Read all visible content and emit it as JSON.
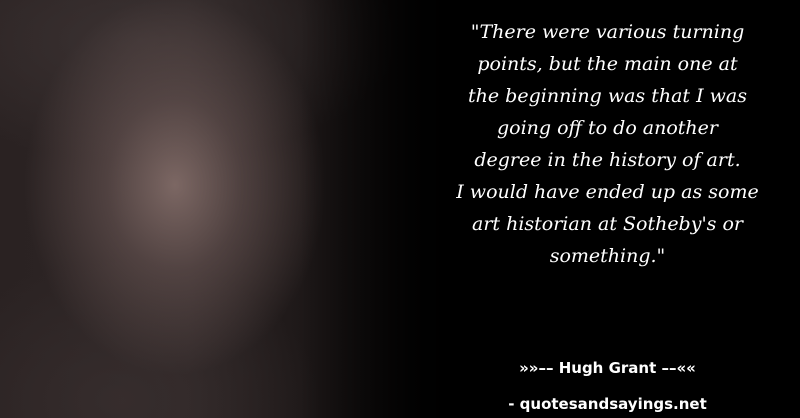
{
  "quote": {
    "lines": [
      "\"There were various turning",
      "points, but the main one at",
      "the beginning was that I was",
      "going off to do another",
      "degree in the history of art.",
      "I would have ended up as some",
      "art historian at Sotheby's or",
      "something.\""
    ]
  },
  "author": "»»–– Hugh Grant ––««",
  "site": "- quotesandsayings.net"
}
